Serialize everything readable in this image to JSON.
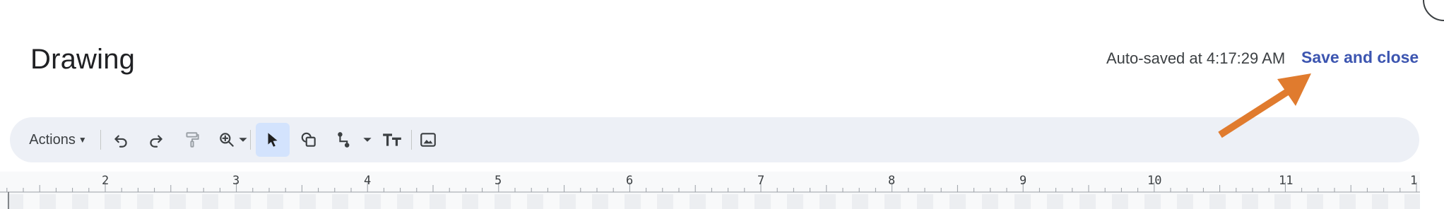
{
  "header": {
    "title": "Drawing",
    "autosave_text": "Auto-saved at 4:17:29 AM",
    "save_close_label": "Save and close"
  },
  "toolbar": {
    "actions_label": "Actions",
    "items": [
      {
        "name": "undo-icon"
      },
      {
        "name": "redo-icon"
      },
      {
        "name": "paint-format-icon"
      },
      {
        "name": "zoom-icon"
      },
      {
        "name": "select-icon"
      },
      {
        "name": "shape-icon"
      },
      {
        "name": "line-icon"
      },
      {
        "name": "text-box-icon"
      },
      {
        "name": "image-icon"
      }
    ]
  },
  "ruler": {
    "labels": [
      "2",
      "3",
      "4",
      "5",
      "6",
      "7",
      "8",
      "9",
      "10",
      "11",
      "1"
    ]
  },
  "colors": {
    "accent": "#3c55b0",
    "arrow": "#e07b2e",
    "toolbar_bg": "#edf0f6",
    "selected_tool_bg": "#d3e3fd"
  }
}
